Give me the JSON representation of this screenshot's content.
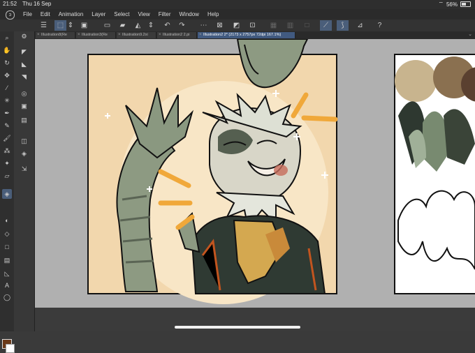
{
  "status": {
    "time": "21:52",
    "date": "Thu 16 Sep",
    "battery": "56%",
    "battery_level": 0.56
  },
  "menu": {
    "items": [
      "File",
      "Edit",
      "Animation",
      "Layer",
      "Select",
      "View",
      "Filter",
      "Window",
      "Help"
    ]
  },
  "tabs": [
    {
      "label": "Illustration8(Re"
    },
    {
      "label": "Illustration3(Re"
    },
    {
      "label": "Illustration9.2xi"
    },
    {
      "label": "Illustration2 2.pi"
    },
    {
      "label": "Illustration2 2* (2173 x 2757px 72dpi 167.1%)"
    }
  ],
  "colors": {
    "accent": "#4a5e7a",
    "active_tab": "#415a80",
    "canvas_bg": "#f2d7ad",
    "swatches": [
      "#c8b48e",
      "#8a7050",
      "#5a4030",
      "#2e3830",
      "#788a70",
      "#a0b098",
      "#3a4438"
    ]
  },
  "icons": {
    "toolbar": [
      "menu-icon",
      "select-layer-icon",
      "stabilizer-icon",
      "transform-icon",
      "save-icon",
      "open-icon",
      "fill-icon",
      "undo-icon",
      "redo-icon",
      "selection-icon",
      "deselect-icon",
      "invert-selection-icon",
      "crop-icon",
      "snap-icon",
      "ruler-icon",
      "vector-icon",
      "help-icon"
    ],
    "tools": [
      "zoom-icon",
      "hand-icon",
      "rotate-icon",
      "move-icon",
      "eyedropper-icon",
      "magic-wand-icon",
      "pen-icon",
      "pencil-icon",
      "brush-icon",
      "airbrush-icon",
      "decoration-icon",
      "eraser-icon",
      "fill-tool-icon",
      "gradient-icon",
      "figure-icon",
      "frame-icon",
      "ruler-tool-icon",
      "text-icon",
      "balloon-icon",
      "correct-line-icon"
    ]
  }
}
